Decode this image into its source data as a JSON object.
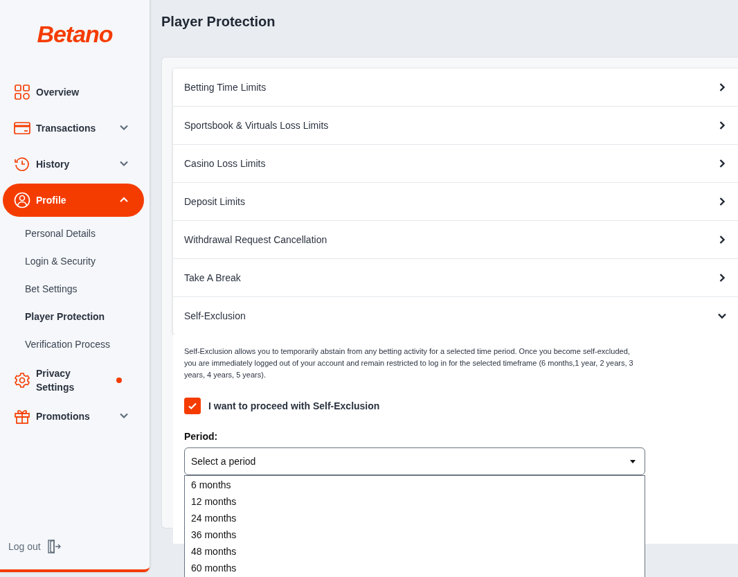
{
  "sidebar": {
    "logo": "Betano",
    "items": [
      {
        "label": "Overview",
        "selected": false
      },
      {
        "label": "Transactions",
        "selected": false,
        "expanded": false
      },
      {
        "label": "History",
        "selected": false,
        "expanded": false
      },
      {
        "label": "Profile",
        "selected": true,
        "expanded": true,
        "children": [
          {
            "label": "Personal Details",
            "selected": false
          },
          {
            "label": "Login & Security",
            "selected": false
          },
          {
            "label": "Bet Settings",
            "selected": false
          },
          {
            "label": "Player Protection",
            "selected": true
          },
          {
            "label": "Verification Process",
            "selected": false
          }
        ]
      },
      {
        "label": "Privacy Settings",
        "selected": false,
        "notification": true
      },
      {
        "label": "Promotions",
        "selected": false,
        "expanded": false
      }
    ],
    "logout": "Log out"
  },
  "page_title": "Player Protection",
  "sections": [
    {
      "title": "Betting Time Limits",
      "expanded": false
    },
    {
      "title": "Sportsbook & Virtuals Loss Limits",
      "expanded": false
    },
    {
      "title": "Casino Loss Limits",
      "expanded": false
    },
    {
      "title": "Deposit Limits",
      "expanded": false
    },
    {
      "title": "Withdrawal Request Cancellation",
      "expanded": false
    },
    {
      "title": "Take A Break",
      "expanded": false
    },
    {
      "title": "Self-Exclusion",
      "expanded": true
    }
  ],
  "self_exclusion": {
    "description": "Self-Exclusion allows you to temporarily abstain from any betting activity for a selected time period. Once you become self-excluded, you are immediately logged out of your account and remain restricted to log in for the selected timeframe (6 months,1 year, 2 years, 3 years, 4 years, 5 years).",
    "confirm": {
      "label": "I want to proceed with Self-Exclusion",
      "checked": true
    },
    "period_label": "Period:",
    "period": {
      "placeholder": "Select a period",
      "open": true,
      "options": [
        "6 months",
        "12 months",
        "24 months",
        "36 months",
        "48 months",
        "60 months"
      ]
    }
  }
}
